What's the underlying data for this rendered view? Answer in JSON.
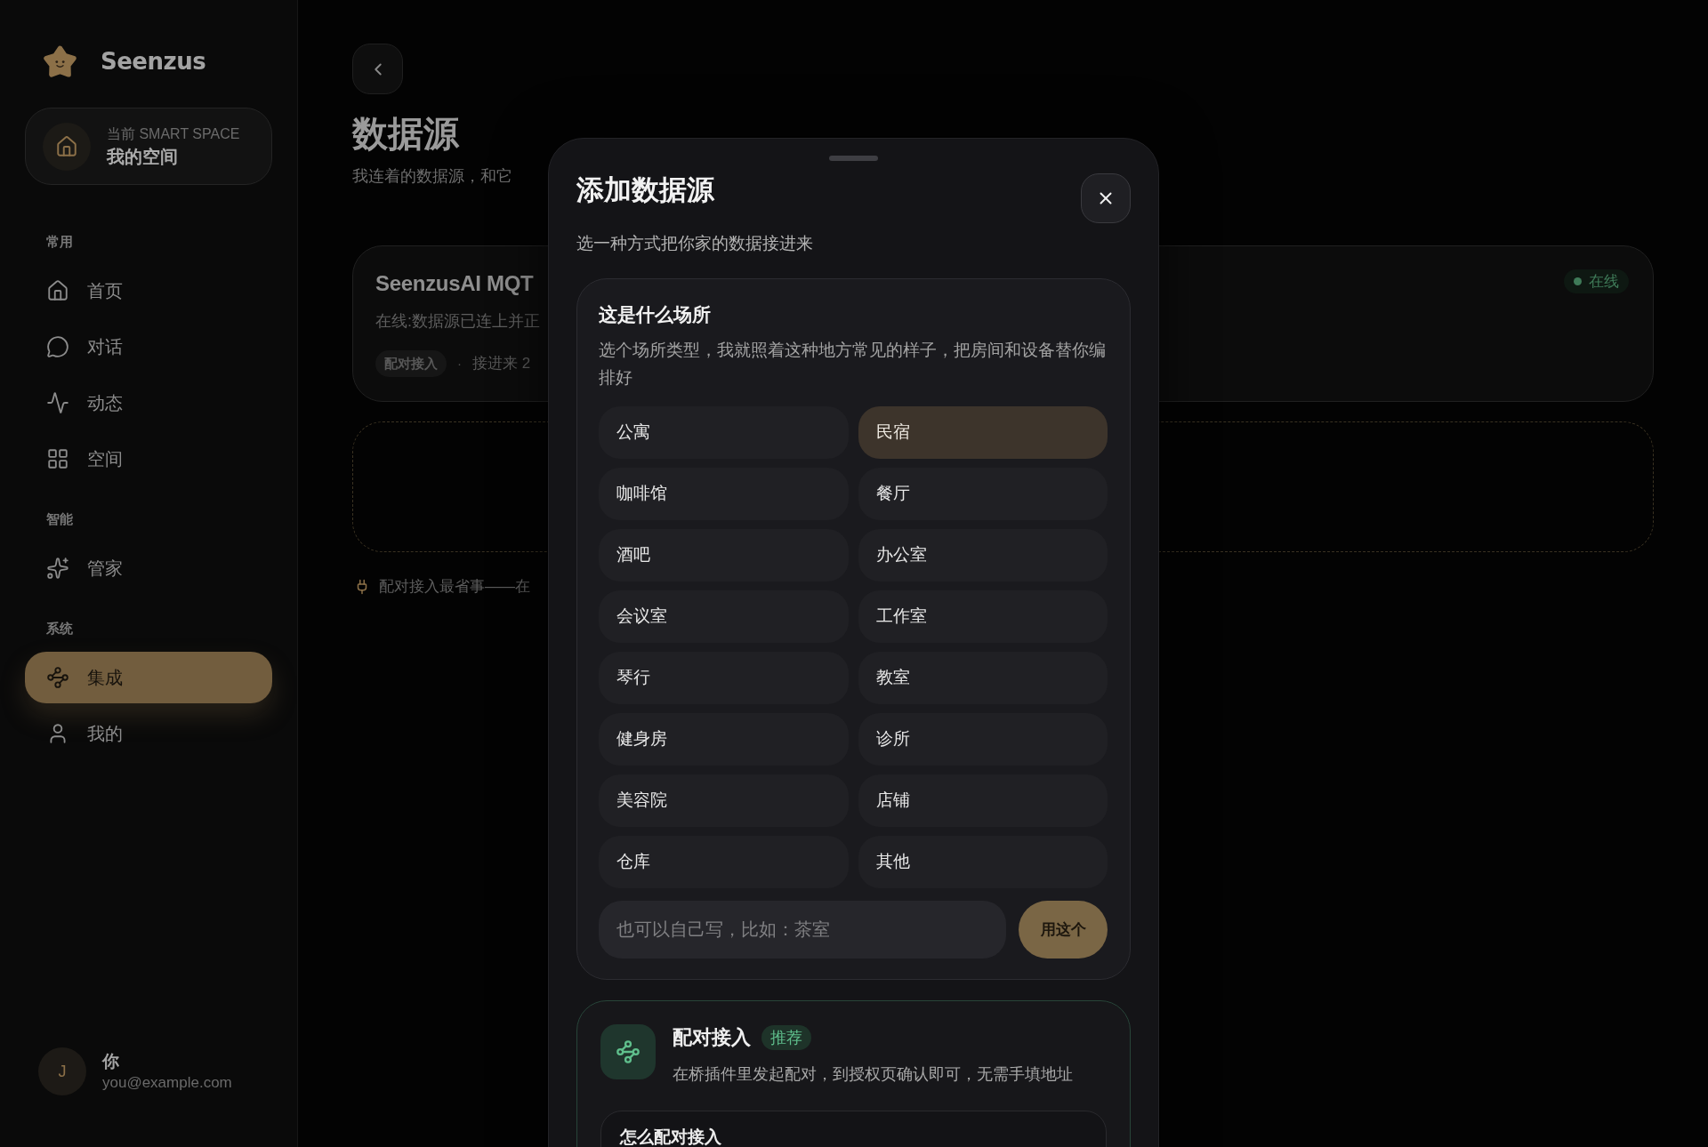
{
  "sidebar": {
    "brand": "Seenzus",
    "current_space": {
      "label": "当前 SMART SPACE",
      "name": "我的空间"
    },
    "sections": [
      {
        "title": "常用",
        "items": [
          {
            "label": "首页",
            "selected": false
          },
          {
            "label": "对话",
            "selected": false
          },
          {
            "label": "动态",
            "selected": false
          },
          {
            "label": "空间",
            "selected": false
          }
        ]
      },
      {
        "title": "智能",
        "items": [
          {
            "label": "管家",
            "selected": false
          }
        ]
      },
      {
        "title": "系统",
        "items": [
          {
            "label": "集成",
            "selected": true
          },
          {
            "label": "我的",
            "selected": false
          }
        ]
      }
    ],
    "user": {
      "initial": "J",
      "name": "你",
      "email": "you@example.com"
    }
  },
  "page": {
    "title": "数据源",
    "subtitle": "我连着的数据源，和它",
    "sources": [
      {
        "name": "SeenzusAI MQT",
        "status_text": "在线:数据源已连上并正",
        "tag": "配对接入",
        "separator": "·",
        "meta": "接进来 2",
        "status": "在线"
      }
    ],
    "hint": "配对接入最省事——在"
  },
  "dialog": {
    "title": "添加数据源",
    "subtitle": "选一种方式把你家的数据接进来",
    "venue": {
      "heading": "这是什么场所",
      "description": "选个场所类型，我就照着这种地方常见的样子，把房间和设备替你编排好",
      "options": [
        {
          "label": "公寓",
          "selected": false
        },
        {
          "label": "民宿",
          "selected": true
        },
        {
          "label": "咖啡馆",
          "selected": false
        },
        {
          "label": "餐厅",
          "selected": false
        },
        {
          "label": "酒吧",
          "selected": false
        },
        {
          "label": "办公室",
          "selected": false
        },
        {
          "label": "会议室",
          "selected": false
        },
        {
          "label": "工作室",
          "selected": false
        },
        {
          "label": "琴行",
          "selected": false
        },
        {
          "label": "教室",
          "selected": false
        },
        {
          "label": "健身房",
          "selected": false
        },
        {
          "label": "诊所",
          "selected": false
        },
        {
          "label": "美容院",
          "selected": false
        },
        {
          "label": "店铺",
          "selected": false
        },
        {
          "label": "仓库",
          "selected": false
        },
        {
          "label": "其他",
          "selected": false
        }
      ],
      "input": {
        "placeholder": "也可以自己写，比如：茶室"
      },
      "submit": "用这个"
    },
    "methods": [
      {
        "title": "配对接入",
        "badge": "推荐",
        "description": "在桥插件里发起配对，到授权页确认即可，无需手填地址",
        "steps_title": "怎么配对接入"
      }
    ]
  }
}
